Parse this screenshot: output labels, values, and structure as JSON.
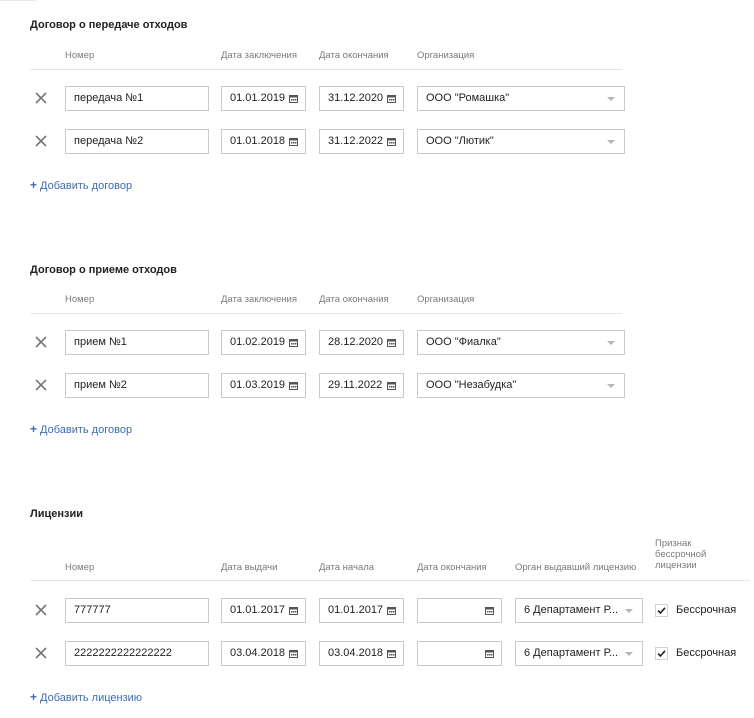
{
  "transfer": {
    "title": "Договор о передаче отходов",
    "headers": {
      "number": "Номер",
      "conclusion_date": "Дата заключения",
      "end_date": "Дата окончания",
      "organization": "Организация"
    },
    "rows": [
      {
        "number": "передача №1",
        "conclusion_date": "01.01.2019",
        "end_date": "31.12.2020",
        "organization": "ООО \"Ромашка\""
      },
      {
        "number": "передача №2",
        "conclusion_date": "01.01.2018",
        "end_date": "31.12.2022",
        "organization": "ООО \"Лютик\""
      }
    ],
    "add_label": "Добавить договор"
  },
  "reception": {
    "title": "Договор о приеме отходов",
    "headers": {
      "number": "Номер",
      "conclusion_date": "Дата заключения",
      "end_date": "Дата окончания",
      "organization": "Организация"
    },
    "rows": [
      {
        "number": "прием №1",
        "conclusion_date": "01.02.2019",
        "end_date": "28.12.2020",
        "organization": "ООО \"Фиалка\""
      },
      {
        "number": "прием №2",
        "conclusion_date": "01.03.2019",
        "end_date": "29.11.2022",
        "organization": "ООО \"Незабудка\""
      }
    ],
    "add_label": "Добавить договор"
  },
  "licenses": {
    "title": "Лицензии",
    "headers": {
      "number": "Номер",
      "issue_date": "Дата выдачи",
      "start_date": "Дата начала",
      "end_date": "Дата окончания",
      "issuer": "Орган выдавший лицензию",
      "perpetual": "Признак бессрочной лицензии"
    },
    "rows": [
      {
        "number": "777777",
        "issue_date": "01.01.2017",
        "start_date": "01.01.2017",
        "end_date": "",
        "issuer": "6 Департамент Р...",
        "perpetual_checked": true,
        "perpetual_label": "Бессрочная"
      },
      {
        "number": "2222222222222222",
        "issue_date": "03.04.2018",
        "start_date": "03.04.2018",
        "end_date": "",
        "issuer": "6 Департамент Р...",
        "perpetual_checked": true,
        "perpetual_label": "Бессрочная"
      }
    ],
    "add_label": "Добавить лицензию"
  },
  "icons": {
    "remove": "close-icon",
    "date": "calendar-icon",
    "select": "chevron-down-icon",
    "add": "plus-icon",
    "check": "checkmark-icon"
  },
  "colors": {
    "link": "#3a6db5",
    "border": "#c9c9c9",
    "header_text": "#7a7a7a"
  }
}
